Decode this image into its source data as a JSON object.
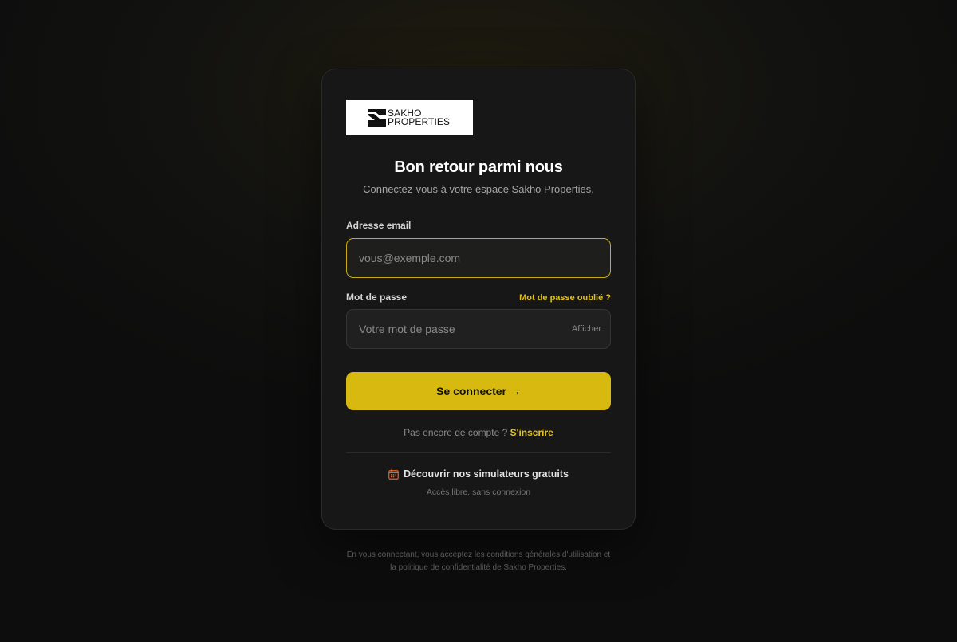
{
  "brand": {
    "logo_line1": "SAKHO",
    "logo_line2": "PROPERTIES"
  },
  "header": {
    "title": "Bon retour parmi nous",
    "subtitle": "Connectez-vous à votre espace Sakho Properties."
  },
  "form": {
    "email_label": "Adresse email",
    "email_placeholder": "vous@exemple.com",
    "email_value": "",
    "password_label": "Mot de passe",
    "forgot_label": "Mot de passe oublié ?",
    "password_placeholder": "Votre mot de passe",
    "password_value": "",
    "show_label": "Afficher",
    "submit_label": "Se connecter →"
  },
  "signup": {
    "prompt": "Pas encore de compte ?",
    "link_label": "S'inscrire"
  },
  "simulators": {
    "icon": "calendar-icon",
    "label": "Découvrir nos simulateurs gratuits",
    "sublabel": "Accès libre, sans connexion"
  },
  "legal": {
    "line1": "En vous connectant, vous acceptez les conditions générales d'utilisation et",
    "line2": "la politique de confidentialité de Sakho Properties."
  },
  "colors": {
    "accent": "#d7b90f",
    "background": "#0e0e0e",
    "card": "#171717",
    "simulator_icon": "#e0652a"
  }
}
